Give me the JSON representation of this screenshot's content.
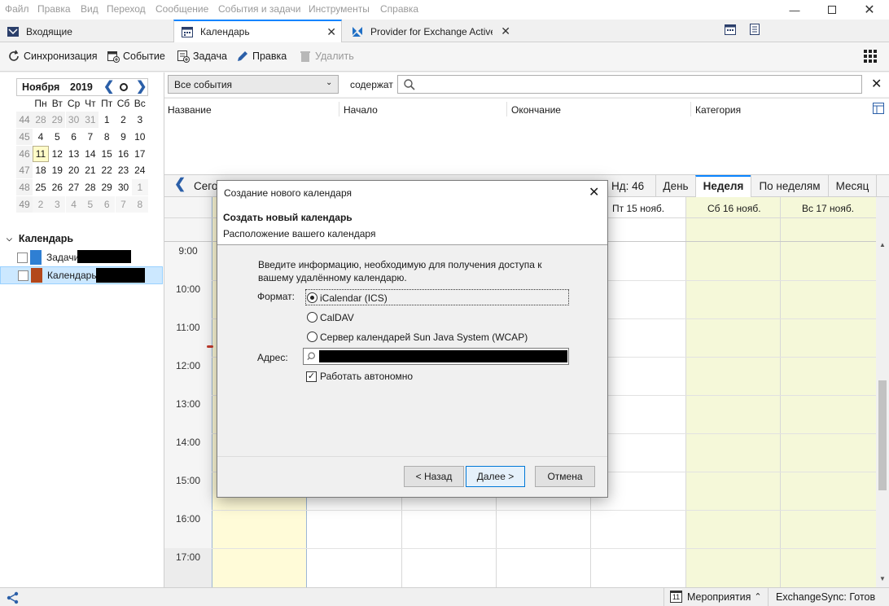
{
  "menubar": {
    "items": [
      "Файл",
      "Правка",
      "Вид",
      "Переход",
      "Сообщение",
      "События и задачи",
      "Инструменты",
      "Справка"
    ]
  },
  "tabs": [
    {
      "label": "Входящие"
    },
    {
      "label": "Календарь"
    },
    {
      "label": "Provider for Exchange ActiveSync"
    }
  ],
  "toolbar": {
    "sync": "Синхронизация",
    "event": "Событие",
    "task": "Задача",
    "edit": "Правка",
    "delete": "Удалить"
  },
  "minical": {
    "month": "Ноября",
    "year": "2019",
    "weekdays": [
      "Пн",
      "Вт",
      "Ср",
      "Чт",
      "Пт",
      "Сб",
      "Вс"
    ],
    "weeks": [
      {
        "num": "44",
        "days": [
          "28",
          "29",
          "30",
          "31",
          "1",
          "2",
          "3"
        ]
      },
      {
        "num": "45",
        "days": [
          "4",
          "5",
          "6",
          "7",
          "8",
          "9",
          "10"
        ]
      },
      {
        "num": "46",
        "days": [
          "11",
          "12",
          "13",
          "14",
          "15",
          "16",
          "17"
        ]
      },
      {
        "num": "47",
        "days": [
          "18",
          "19",
          "20",
          "21",
          "22",
          "23",
          "24"
        ]
      },
      {
        "num": "48",
        "days": [
          "25",
          "26",
          "27",
          "28",
          "29",
          "30",
          "1"
        ]
      },
      {
        "num": "49",
        "days": [
          "2",
          "3",
          "4",
          "5",
          "6",
          "7",
          "8"
        ]
      }
    ]
  },
  "calendars": {
    "header": "Календарь",
    "items": [
      {
        "label": "Задачи",
        "color": "#2f7fd3"
      },
      {
        "label": "Календарь",
        "color": "#b3471b"
      }
    ]
  },
  "filter": {
    "select": "Все события",
    "contains_label": "содержат",
    "search_value": ""
  },
  "list_columns": [
    "Название",
    "Начало",
    "Окончание",
    "Категория"
  ],
  "viewbar": {
    "today": "Сегодня",
    "week_num": "Нд: 46",
    "views": [
      "День",
      "Неделя",
      "По неделям",
      "Месяц"
    ],
    "active_view": "Неделя"
  },
  "day_headers": [
    "Пт 15 нояб.",
    "Сб 16 нояб.",
    "Вс 17 нояб."
  ],
  "hours": [
    "9:00",
    "10:00",
    "11:00",
    "12:00",
    "13:00",
    "14:00",
    "15:00",
    "16:00",
    "17:00"
  ],
  "dialog": {
    "title": "Создание нового календаря",
    "heading": "Создать новый календарь",
    "subheading": "Расположение вашего календаря",
    "intro_line1": "Введите информацию, необходимую для получения доступа к",
    "intro_line2": "вашему удалённому календарю.",
    "format_label": "Формат:",
    "formats": [
      "iCalendar (ICS)",
      "CalDAV",
      "Сервер календарей Sun Java System (WCAP)"
    ],
    "selected_format": "iCalendar (ICS)",
    "address_label": "Адрес:",
    "offline_label": "Работать автономно",
    "offline_checked": true,
    "back": "< Назад",
    "next": "Далее >",
    "cancel": "Отмена"
  },
  "statusbar": {
    "events_day": "11",
    "events_label": "Мероприятия",
    "sync_status": "ExchangeSync: Готов"
  }
}
